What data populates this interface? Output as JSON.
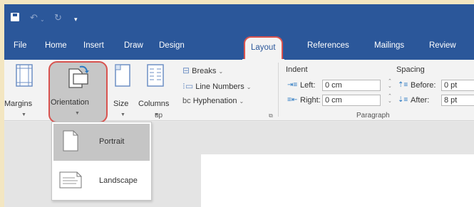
{
  "quick_access": {
    "icons": [
      "save-icon",
      "undo-icon",
      "redo-icon",
      "customize-icon"
    ]
  },
  "tabs": [
    {
      "label": "File"
    },
    {
      "label": "Home"
    },
    {
      "label": "Insert"
    },
    {
      "label": "Draw"
    },
    {
      "label": "Design"
    },
    {
      "label": "Layout"
    },
    {
      "label": "References"
    },
    {
      "label": "Mailings"
    },
    {
      "label": "Review"
    }
  ],
  "active_tab": "Layout",
  "page_setup": {
    "margins": "Margins",
    "orientation": "Orientation",
    "size": "Size",
    "columns": "Columns",
    "breaks": "Breaks",
    "line_numbers": "Line Numbers",
    "hyphenation": "Hyphenation",
    "group_label_partial": "up"
  },
  "paragraph": {
    "indent_title": "Indent",
    "spacing_title": "Spacing",
    "left_label": "Left:",
    "left_value": "0 cm",
    "right_label": "Right:",
    "right_value": "0 cm",
    "before_label": "Before:",
    "before_value": "0 pt",
    "after_label": "After:",
    "after_value": "8 pt",
    "group_label": "Paragraph"
  },
  "orientation_menu": {
    "items": [
      {
        "label": "Portrait",
        "selected": true
      },
      {
        "label": "Landscape",
        "selected": false
      }
    ]
  },
  "colors": {
    "accent": "#2b579a",
    "highlight_ring": "#d9534f",
    "frame": "#f3e6c1"
  }
}
